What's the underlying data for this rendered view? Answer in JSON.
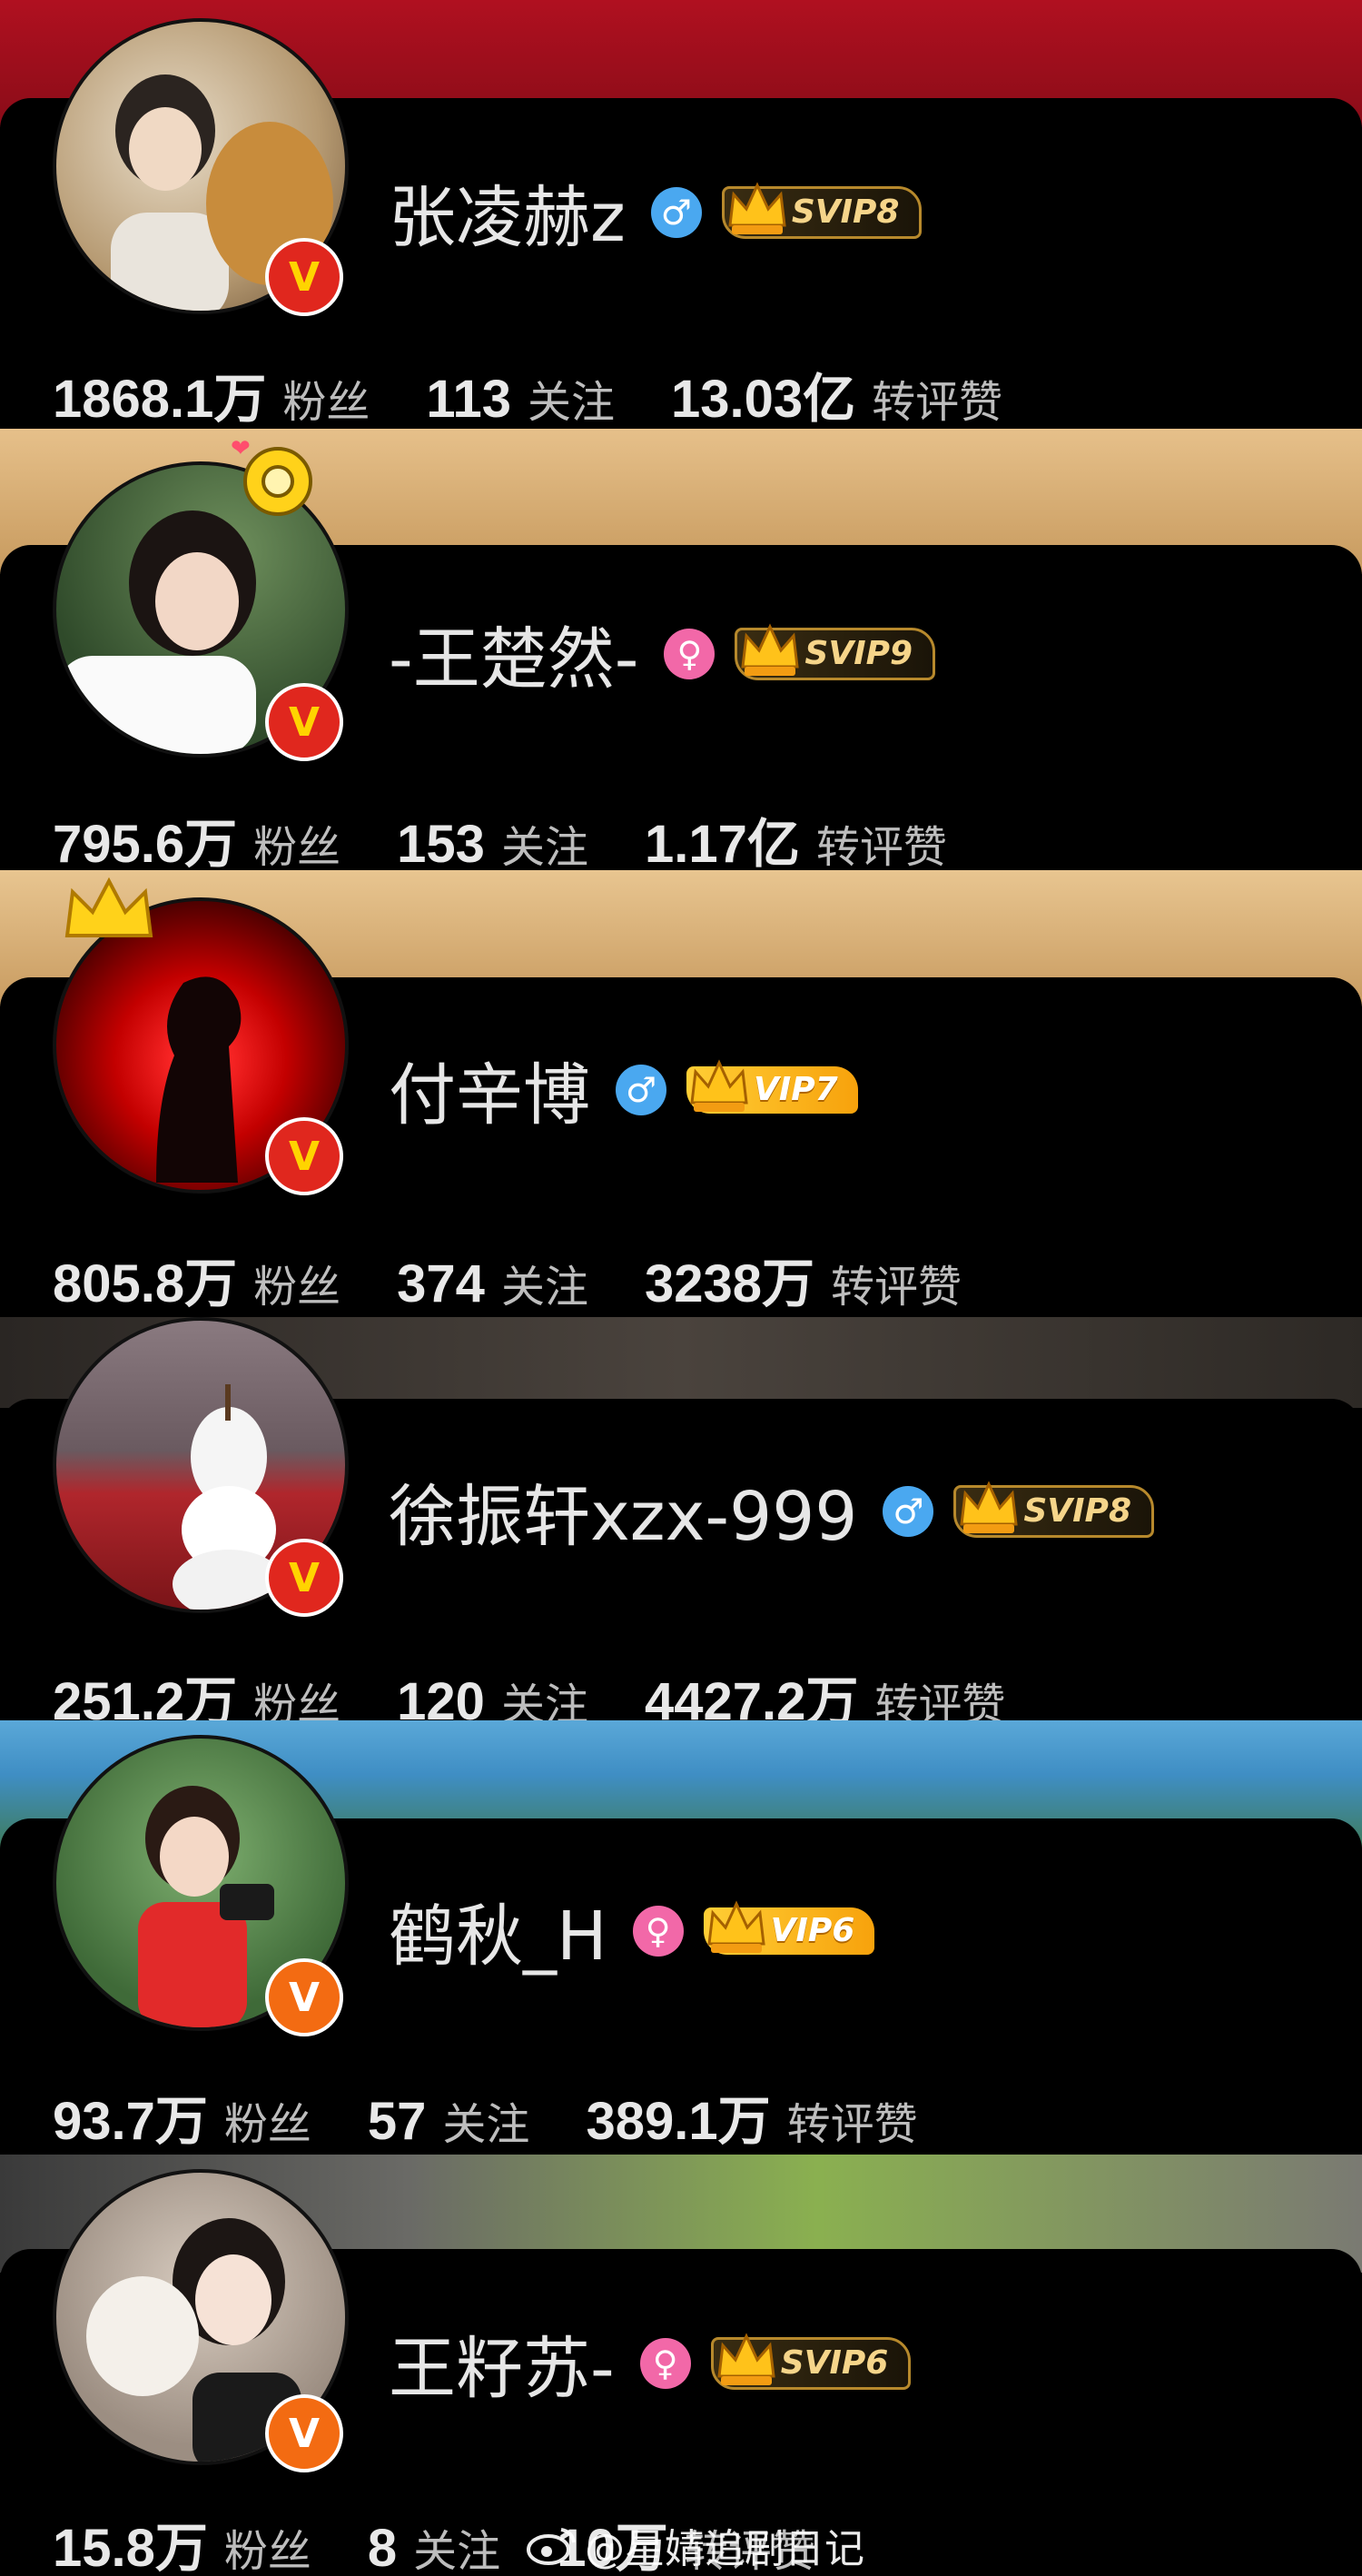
{
  "profiles": [
    {
      "name": "张凌赫z",
      "gender": "♂",
      "vip": "SVIP8",
      "fans": "1868.1万",
      "fans_label": "粉丝",
      "following": "113",
      "following_label": "关注",
      "engagement": "13.03亿",
      "engagement_label": "转评赞"
    },
    {
      "name": "-王楚然-",
      "gender": "♀",
      "vip": "SVIP9",
      "fans": "795.6万",
      "fans_label": "粉丝",
      "following": "153",
      "following_label": "关注",
      "engagement": "1.17亿",
      "engagement_label": "转评赞"
    },
    {
      "name": "付辛博",
      "gender": "♂",
      "vip": "VIP7",
      "fans": "805.8万",
      "fans_label": "粉丝",
      "following": "374",
      "following_label": "关注",
      "engagement": "3238万",
      "engagement_label": "转评赞"
    },
    {
      "name": "徐振轩xzx-999",
      "gender": "♂",
      "vip": "SVIP8",
      "fans": "251.2万",
      "fans_label": "粉丝",
      "following": "120",
      "following_label": "关注",
      "engagement": "4427.2万",
      "engagement_label": "转评赞"
    },
    {
      "name": "鹤秋_H",
      "gender": "♀",
      "vip": "VIP6",
      "fans": "93.7万",
      "fans_label": "粉丝",
      "following": "57",
      "following_label": "关注",
      "engagement": "389.1万",
      "engagement_label": "转评赞"
    },
    {
      "name": "王籽苏-",
      "gender": "♀",
      "vip": "SVIP6",
      "fans": "15.8万",
      "fans_label": "粉丝",
      "following": "8",
      "following_label": "关注",
      "engagement": "10万",
      "engagement_label": "转评赞"
    }
  ],
  "verified_badge": "V",
  "watermark": "@星婧追剧日记",
  "colors": {
    "male": "#4aa8f0",
    "female": "#f268a8",
    "badge_red": "#e0271e",
    "badge_orange": "#f36b12",
    "vip_gold": "#ffce35"
  }
}
